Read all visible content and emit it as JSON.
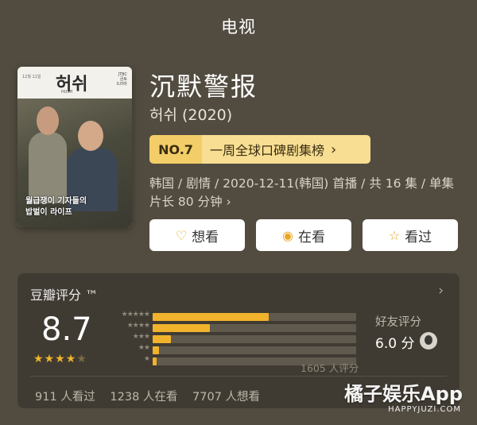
{
  "header": {
    "title": "电视"
  },
  "poster": {
    "logo": "허쉬",
    "logo_sub": "HUSH",
    "side_left": "12월 11일",
    "side_right": [
      "JTBC",
      "금토",
      "드라마"
    ],
    "caption_line1": "월급쟁이 기자들의",
    "caption_line2": "밥벌이 라이프"
  },
  "show": {
    "title": "沉默警报",
    "original_title": "허쉬 (2020)",
    "rank": {
      "no": "NO.7",
      "list": "一周全球口碑剧集榜",
      "arrow": "›"
    },
    "meta": "韩国 / 剧情 / 2020-12-11(韩国) 首播 / 共 16 集 / 单集片长 80 分钟 ›"
  },
  "actions": [
    {
      "label": "想看",
      "icon": "heart-plus-icon",
      "glyph": "♡"
    },
    {
      "label": "在看",
      "icon": "target-icon",
      "glyph": "◉"
    },
    {
      "label": "看过",
      "icon": "star-outline-icon",
      "glyph": "☆"
    }
  ],
  "rating": {
    "title": "豆瓣评分 ™",
    "chevron": "›",
    "score": "8.7",
    "stars_filled": 4.5,
    "distribution": [
      {
        "stars": "★★★★★",
        "fraction": 0.57
      },
      {
        "stars": "★★★★",
        "fraction": 0.28
      },
      {
        "stars": "★★★",
        "fraction": 0.09
      },
      {
        "stars": "★★",
        "fraction": 0.03
      },
      {
        "stars": "★",
        "fraction": 0.02
      }
    ],
    "count": "1605 人评分",
    "friends_label": "好友评分",
    "friends_score": "6.0 分",
    "stats": [
      "911 人看过",
      "1238 人在看",
      "7707 人想看"
    ]
  },
  "watermark": {
    "main": "橘子娱乐App",
    "sub": "HAPPYJUZI.COM"
  },
  "colors": {
    "background": "#524c40",
    "card": "#403b32",
    "accent": "#f0b32b",
    "badge": "#f8de93"
  }
}
